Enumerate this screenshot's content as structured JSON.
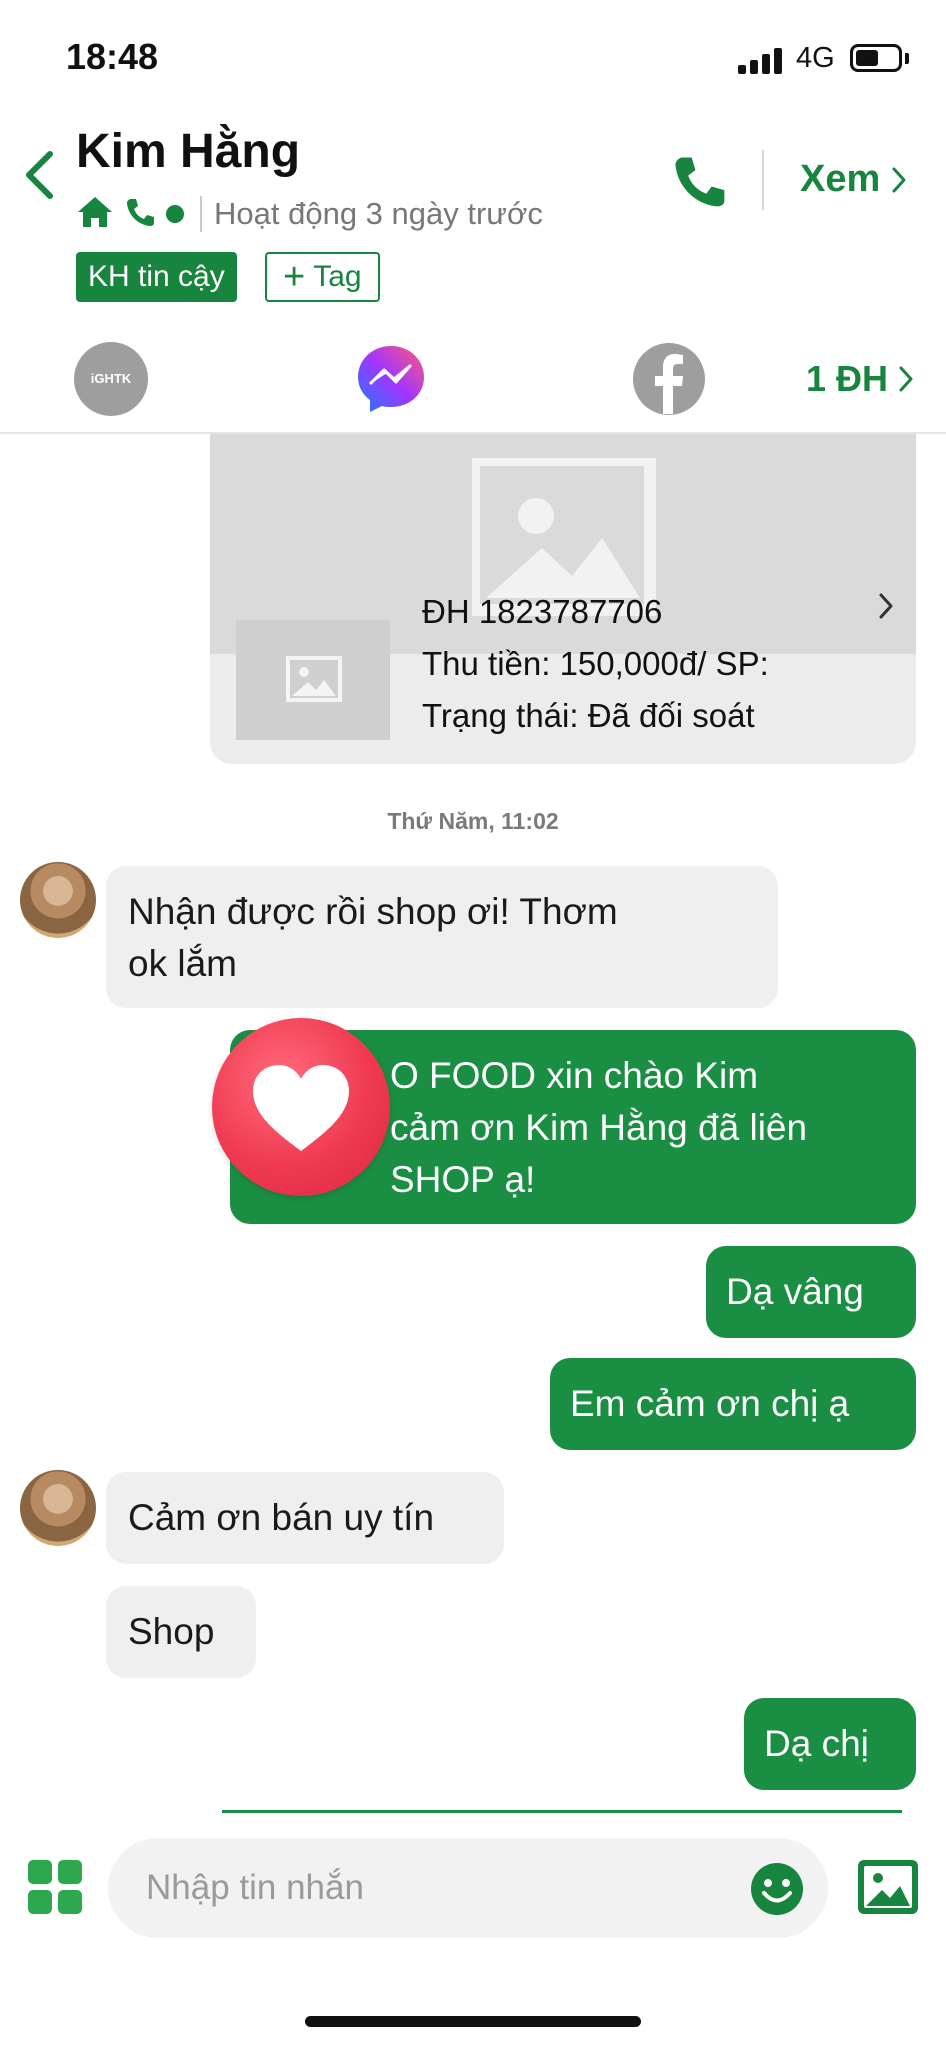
{
  "status_bar": {
    "time": "18:48",
    "network": "4G",
    "battery_level": 0.55
  },
  "header": {
    "contact_name": "Kim Hằng",
    "last_active": "Hoạt động 3 ngày trước",
    "view_label": "Xem",
    "tags": {
      "trusted": "KH tin cậy",
      "add_tag": "Tag"
    }
  },
  "channels": {
    "ghtk_label": "iGHTK",
    "orders_label": "1 ĐH"
  },
  "order_card": {
    "order_id": "ĐH 1823787706",
    "amount": "Thu tiền: 150,000đ/ SP:",
    "status": "Trạng thái: Đã đối soát"
  },
  "date_separator": "Thứ Năm, 11:02",
  "messages": [
    {
      "side": "in",
      "lines": [
        "Nhận được rồi shop ơi! Thơm",
        "ok lắm"
      ]
    },
    {
      "side": "out",
      "lines": [
        "O FOOD xin chào Kim",
        "cảm ơn Kim Hằng  đã liên",
        "SHOP ạ!"
      ]
    },
    {
      "side": "out",
      "text": "Dạ vâng"
    },
    {
      "side": "out",
      "text": "Em cảm ơn chị ạ"
    },
    {
      "side": "in",
      "text": "Cảm ơn bán uy tín"
    },
    {
      "side": "in",
      "text": "Shop"
    },
    {
      "side": "out",
      "text": "Dạ chị"
    }
  ],
  "reaction": "heart",
  "composer": {
    "placeholder": "Nhập tin nhắn"
  },
  "colors": {
    "accent": "#17853e",
    "bubble_out": "#1a8e43",
    "bubble_in": "#efefef",
    "reaction": "#f03a52"
  },
  "icons": [
    "back-chevron-icon",
    "home-icon",
    "phone-icon",
    "online-dot-icon",
    "call-icon",
    "chevron-right-icon",
    "messenger-icon",
    "facebook-icon",
    "image-placeholder-icon",
    "heart-icon",
    "apps-grid-icon",
    "emoji-icon",
    "gallery-icon"
  ]
}
